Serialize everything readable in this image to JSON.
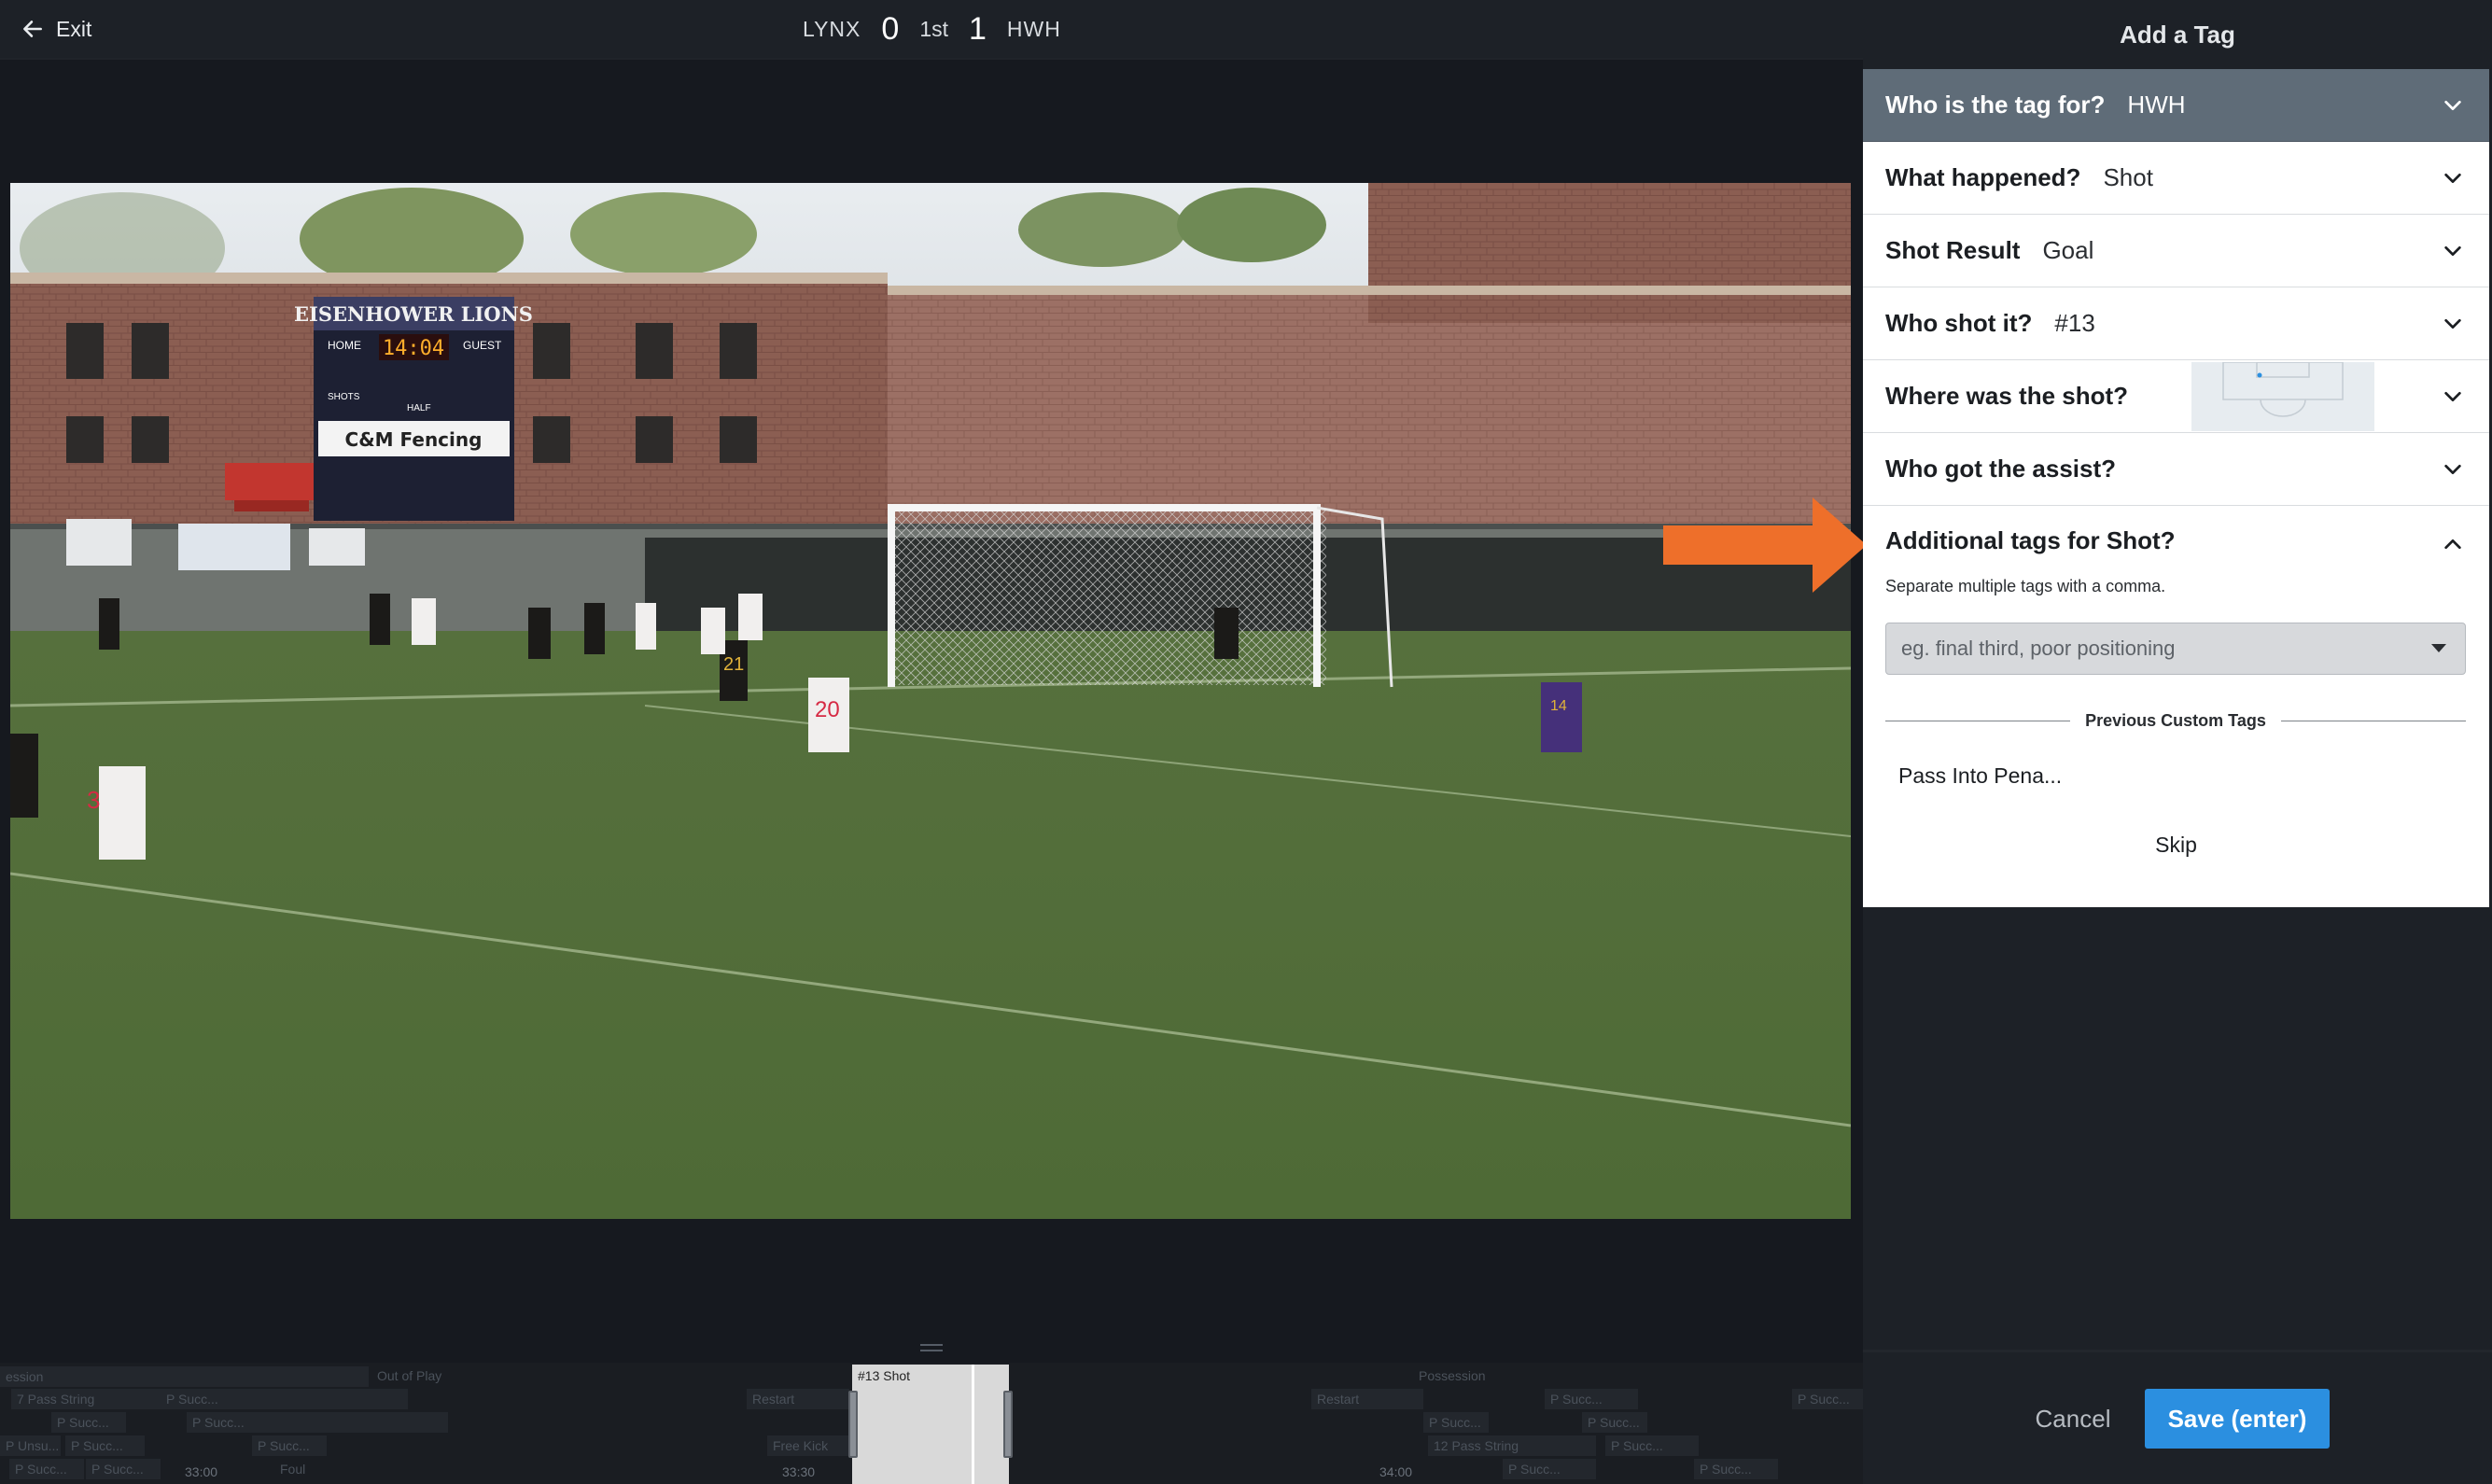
{
  "topbar": {
    "exit_label": "Exit",
    "home_team": "LYNX",
    "home_score": "0",
    "period": "1st",
    "away_score": "1",
    "away_team": "HWH"
  },
  "video": {
    "scoreboard_name": "EISENHOWER LIONS",
    "scoreboard_home": "HOME",
    "scoreboard_guest": "GUEST",
    "scoreboard_clock": "14:04",
    "scoreboard_shots": "SHOTS",
    "scoreboard_half": "HALF",
    "sponsor": "C&M Fencing",
    "jersey_3": "3",
    "jersey_20": "20",
    "jersey_21": "21",
    "jersey_14": "14"
  },
  "timeline": {
    "segments": [
      "ession",
      "Out of Play",
      "7 Pass String",
      "P Succ...",
      "P Succ...",
      "P Succ...",
      "P Unsu...",
      "P Succ...",
      "P Succ...",
      "P Succ...",
      "P Succ...",
      "Restart",
      "Free Kick",
      "Foul",
      "Possession",
      "Restart",
      "P Succ...",
      "P Succ...",
      "P Succ...",
      "P Succ...",
      "12 Pass String",
      "P Succ...",
      "P Succ...",
      "P Succ..."
    ],
    "times": [
      "33:00",
      "33:30",
      "34:00"
    ],
    "selection_label": "#13 Shot"
  },
  "panel": {
    "title": "Add a Tag",
    "rows": [
      {
        "question": "Who is the tag for?",
        "answer": "HWH"
      },
      {
        "question": "What happened?",
        "answer": "Shot"
      },
      {
        "question": "Shot Result",
        "answer": "Goal"
      },
      {
        "question": "Who shot it?",
        "answer": "#13"
      },
      {
        "question": "Where was the shot?",
        "answer": ""
      },
      {
        "question": "Who got the assist?",
        "answer": ""
      }
    ],
    "additional_question": "Additional tags for Shot?",
    "hint": "Separate multiple tags with a comma.",
    "input_placeholder": "eg. final third, poor positioning",
    "previous_header": "Previous Custom Tags",
    "previous_tags": [
      "Pass Into Pena..."
    ],
    "skip_label": "Skip",
    "cancel_label": "Cancel",
    "save_label": "Save (enter)"
  },
  "colors": {
    "accent": "#2b8fe0",
    "active_row": "#5f6c78",
    "annotation_arrow": "#ee6f2a"
  },
  "icons": [
    "back-arrow-icon",
    "chevron-down-icon",
    "chevron-up-icon",
    "dropdown-caret-icon",
    "drag-handle-icon"
  ]
}
